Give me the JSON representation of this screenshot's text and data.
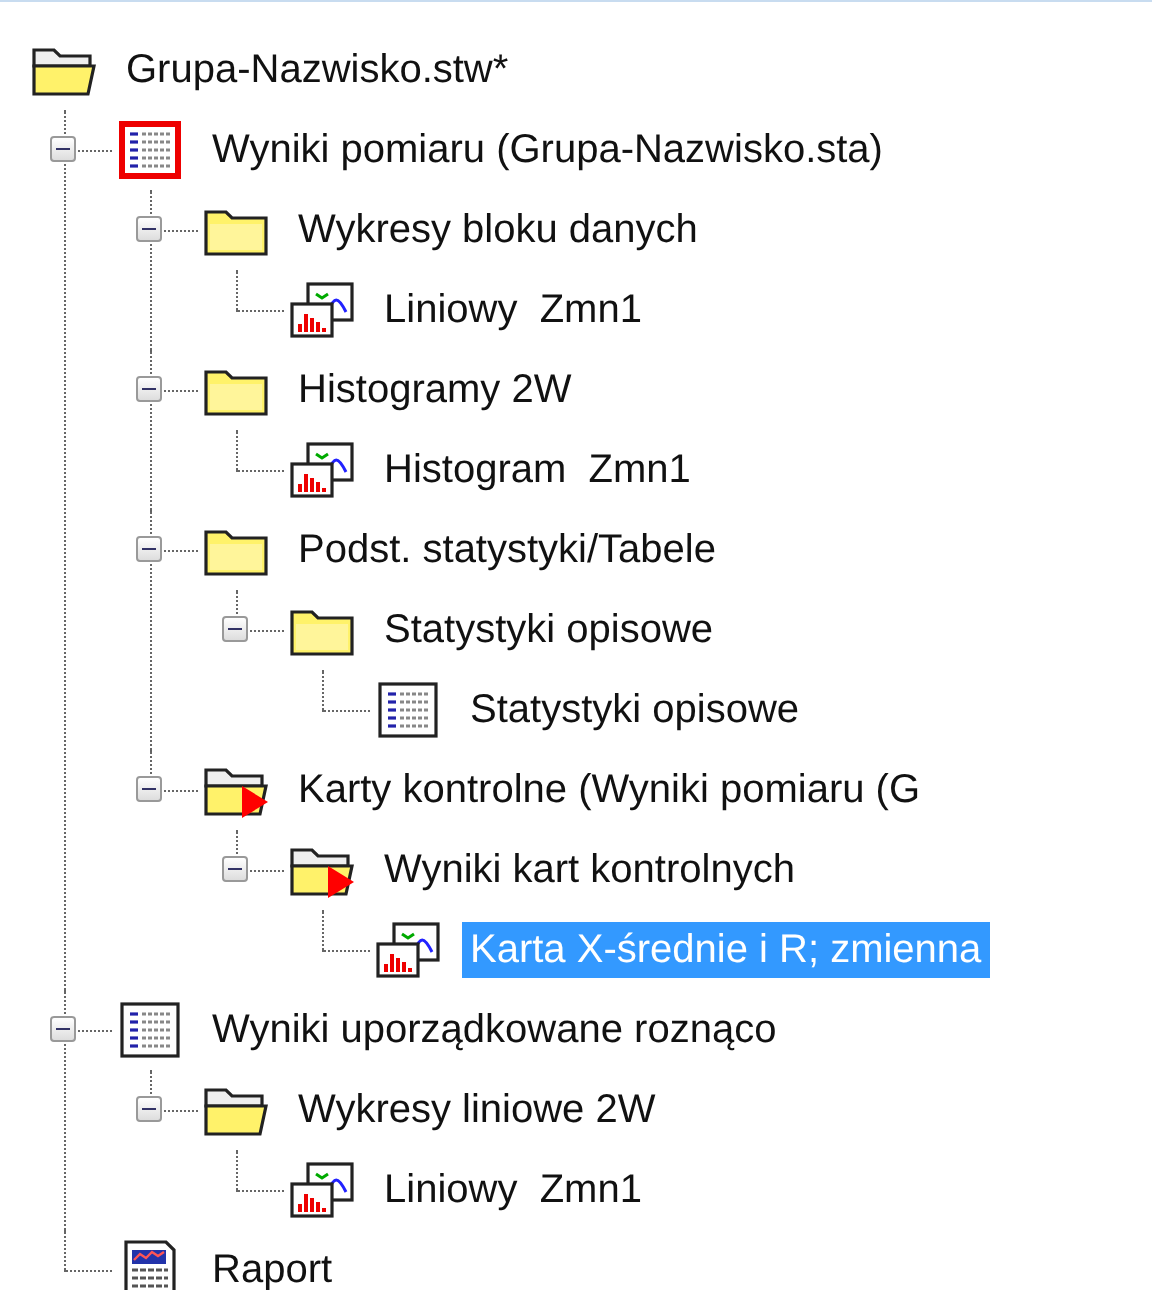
{
  "tree": {
    "label": "Grupa-Nazwisko.stw*",
    "kind": "folder-open",
    "selected": false,
    "children": [
      {
        "label": "Wyniki pomiaru (Grupa-Nazwisko.sta)",
        "kind": "spreadsheet-flagged",
        "expanded": true,
        "selected": false,
        "children": [
          {
            "label": "Wykresy bloku danych",
            "kind": "folder",
            "expanded": true,
            "selected": false,
            "children": [
              {
                "label": "Liniowy  Zmn1",
                "kind": "graph",
                "selected": false
              }
            ]
          },
          {
            "label": "Histogramy 2W",
            "kind": "folder",
            "expanded": true,
            "selected": false,
            "children": [
              {
                "label": "Histogram  Zmn1",
                "kind": "graph",
                "selected": false
              }
            ]
          },
          {
            "label": "Podst. statystyki/Tabele",
            "kind": "folder",
            "expanded": true,
            "selected": false,
            "children": [
              {
                "label": "Statystyki opisowe",
                "kind": "folder",
                "expanded": true,
                "selected": false,
                "children": [
                  {
                    "label": "Statystyki opisowe",
                    "kind": "spreadsheet",
                    "selected": false
                  }
                ]
              }
            ]
          },
          {
            "label": "Karty kontrolne (Wyniki pomiaru (G",
            "kind": "folder-arrow",
            "expanded": true,
            "selected": false,
            "children": [
              {
                "label": "Wyniki kart kontrolnych",
                "kind": "folder-arrow",
                "expanded": true,
                "selected": false,
                "children": [
                  {
                    "label": "Karta X-średnie i R; zmienna",
                    "kind": "graph",
                    "selected": true
                  }
                ]
              }
            ]
          }
        ]
      },
      {
        "label": "Wyniki uporządkowane roznąco",
        "kind": "spreadsheet",
        "expanded": true,
        "selected": false,
        "children": [
          {
            "label": "Wykresy liniowe 2W",
            "kind": "folder-open",
            "expanded": true,
            "selected": false,
            "children": [
              {
                "label": "Liniowy  Zmn1",
                "kind": "graph",
                "selected": false
              }
            ]
          }
        ]
      },
      {
        "label": "Raport",
        "kind": "report",
        "selected": false
      }
    ]
  }
}
